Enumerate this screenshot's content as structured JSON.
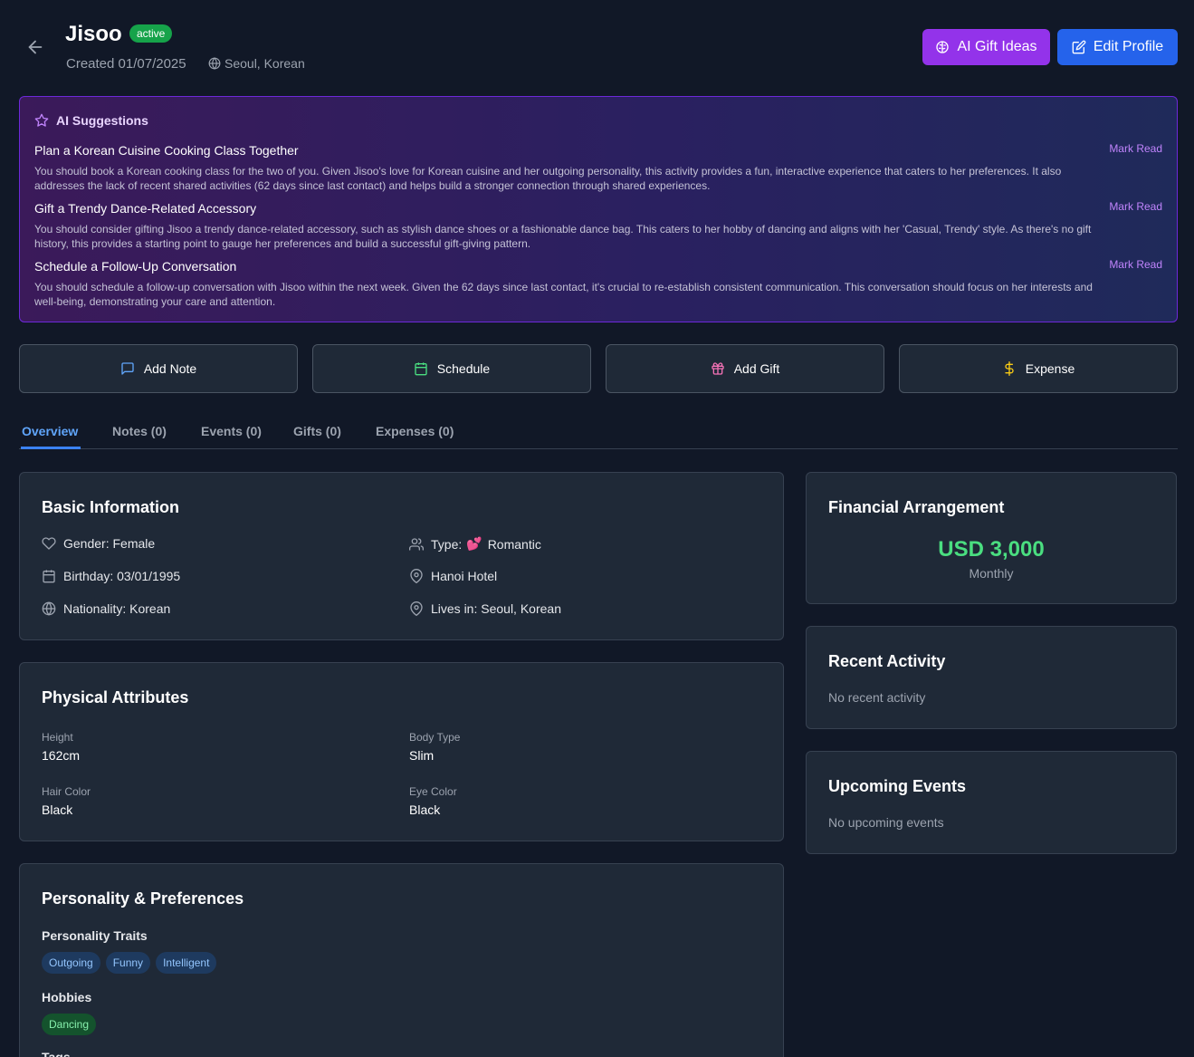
{
  "header": {
    "name": "Jisoo",
    "status": "active",
    "created": "Created 01/07/2025",
    "location": "Seoul, Korean",
    "ai_gift_label": "AI Gift Ideas",
    "edit_label": "Edit Profile"
  },
  "ai_suggestions": {
    "title": "AI Suggestions",
    "mark_read_label": "Mark Read",
    "items": [
      {
        "title": "Plan a Korean Cuisine Cooking Class Together",
        "description": "You should book a Korean cooking class for the two of you. Given Jisoo's love for Korean cuisine and her outgoing personality, this activity provides a fun, interactive experience that caters to her preferences. It also addresses the lack of recent shared activities (62 days since last contact) and helps build a stronger connection through shared experiences."
      },
      {
        "title": "Gift a Trendy Dance-Related Accessory",
        "description": "You should consider gifting Jisoo a trendy dance-related accessory, such as stylish dance shoes or a fashionable dance bag. This caters to her hobby of dancing and aligns with her 'Casual, Trendy' style. As there's no gift history, this provides a starting point to gauge her preferences and build a successful gift-giving pattern."
      },
      {
        "title": "Schedule a Follow-Up Conversation",
        "description": "You should schedule a follow-up conversation with Jisoo within the next week. Given the 62 days since last contact, it's crucial to re-establish consistent communication. This conversation should focus on her interests and well-being, demonstrating your care and attention."
      }
    ]
  },
  "quick_actions": {
    "add_note": "Add Note",
    "schedule": "Schedule",
    "add_gift": "Add Gift",
    "expense": "Expense"
  },
  "tabs": [
    "Overview",
    "Notes (0)",
    "Events (0)",
    "Gifts (0)",
    "Expenses (0)"
  ],
  "basic_info": {
    "title": "Basic Information",
    "gender": "Gender: Female",
    "birthday": "Birthday: 03/01/1995",
    "nationality": "Nationality: Korean",
    "type_label": "Type:",
    "type_emoji": "💕",
    "type_value": "Romantic",
    "place": "Hanoi Hotel",
    "lives_in": "Lives in: Seoul, Korean"
  },
  "physical": {
    "title": "Physical Attributes",
    "height_label": "Height",
    "height": "162cm",
    "body_type_label": "Body Type",
    "body_type": "Slim",
    "hair_label": "Hair Color",
    "hair": "Black",
    "eye_label": "Eye Color",
    "eye": "Black"
  },
  "personality": {
    "title": "Personality & Preferences",
    "traits_label": "Personality Traits",
    "traits": [
      "Outgoing",
      "Funny",
      "Intelligent"
    ],
    "hobbies_label": "Hobbies",
    "hobbies": [
      "Dancing"
    ],
    "tags_label": "Tags"
  },
  "financial": {
    "title": "Financial Arrangement",
    "amount": "USD 3,000",
    "period": "Monthly"
  },
  "recent_activity": {
    "title": "Recent Activity",
    "empty": "No recent activity"
  },
  "upcoming_events": {
    "title": "Upcoming Events",
    "empty": "No upcoming events"
  },
  "colors": {
    "background": "#111827",
    "card": "#1f2937",
    "purple_button": "#9333ea",
    "blue_button": "#2563eb",
    "active_badge": "#16a34a",
    "money_green": "#4ade80",
    "tab_active": "#60a5fa"
  }
}
